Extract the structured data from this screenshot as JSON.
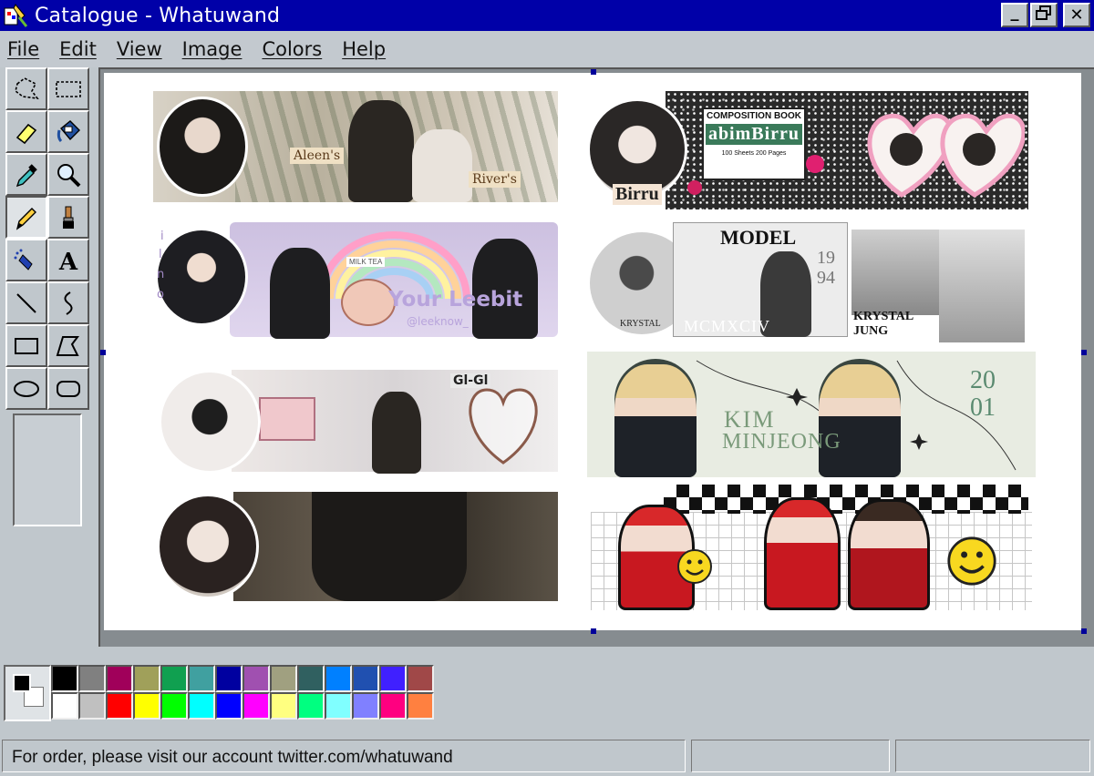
{
  "window": {
    "title": "Catalogue - Whatuwand",
    "minimize_label": "_",
    "maximize_label": "❐",
    "close_label": "✕"
  },
  "menu": [
    {
      "label": "File"
    },
    {
      "label": "Edit"
    },
    {
      "label": "View"
    },
    {
      "label": "Image"
    },
    {
      "label": "Colors"
    },
    {
      "label": "Help"
    }
  ],
  "tools": [
    {
      "name": "free-select-icon"
    },
    {
      "name": "rect-select-icon"
    },
    {
      "name": "eraser-icon"
    },
    {
      "name": "fill-bucket-icon"
    },
    {
      "name": "color-picker-icon"
    },
    {
      "name": "magnifier-icon"
    },
    {
      "name": "pencil-icon",
      "active": true
    },
    {
      "name": "brush-icon"
    },
    {
      "name": "airbrush-icon"
    },
    {
      "name": "text-icon"
    },
    {
      "name": "line-icon"
    },
    {
      "name": "curve-icon"
    },
    {
      "name": "rectangle-icon"
    },
    {
      "name": "polygon-icon"
    },
    {
      "name": "ellipse-icon"
    },
    {
      "name": "rounded-rect-icon"
    }
  ],
  "canvas": {
    "banners": [
      {
        "labels": [
          "Aleen's",
          "River's"
        ]
      },
      {
        "labels": [
          "COMPOSITION BOOK",
          "abimBirru",
          "100 Sheets 200 Pages",
          "Birru"
        ]
      },
      {
        "labels": [
          "i",
          "l",
          "n",
          "o",
          "MILK TEA",
          "Your Leebit",
          "@leeknow_"
        ]
      },
      {
        "labels": [
          "MODEL",
          "19",
          "94",
          "KRYSTAL",
          "MCMXCIV",
          "KRYSTAL",
          "JUNG"
        ]
      },
      {
        "labels": [
          "Gl-Gl"
        ]
      },
      {
        "labels": [
          "KIM",
          "MINJEONG",
          "20",
          "01"
        ]
      },
      {
        "labels": []
      },
      {
        "labels": []
      }
    ]
  },
  "palette": {
    "foreground": "#000000",
    "background": "#ffffff",
    "colors": [
      "#000000",
      "#808080",
      "#a0005a",
      "#a0a05a",
      "#10a050",
      "#40a0a0",
      "#0000a0",
      "#a050b0",
      "#a0a080",
      "#306060",
      "#0080ff",
      "#2050b0",
      "#4020ff",
      "#a04848",
      "#ffffff",
      "#c0c0c0",
      "#ff0000",
      "#ffff00",
      "#00ff00",
      "#00ffff",
      "#0000ff",
      "#ff00ff",
      "#ffff80",
      "#00ff80",
      "#80ffff",
      "#8080ff",
      "#ff0080",
      "#ff8040"
    ]
  },
  "status": {
    "message": "For order, please visit our account twitter.com/whatuwand"
  }
}
